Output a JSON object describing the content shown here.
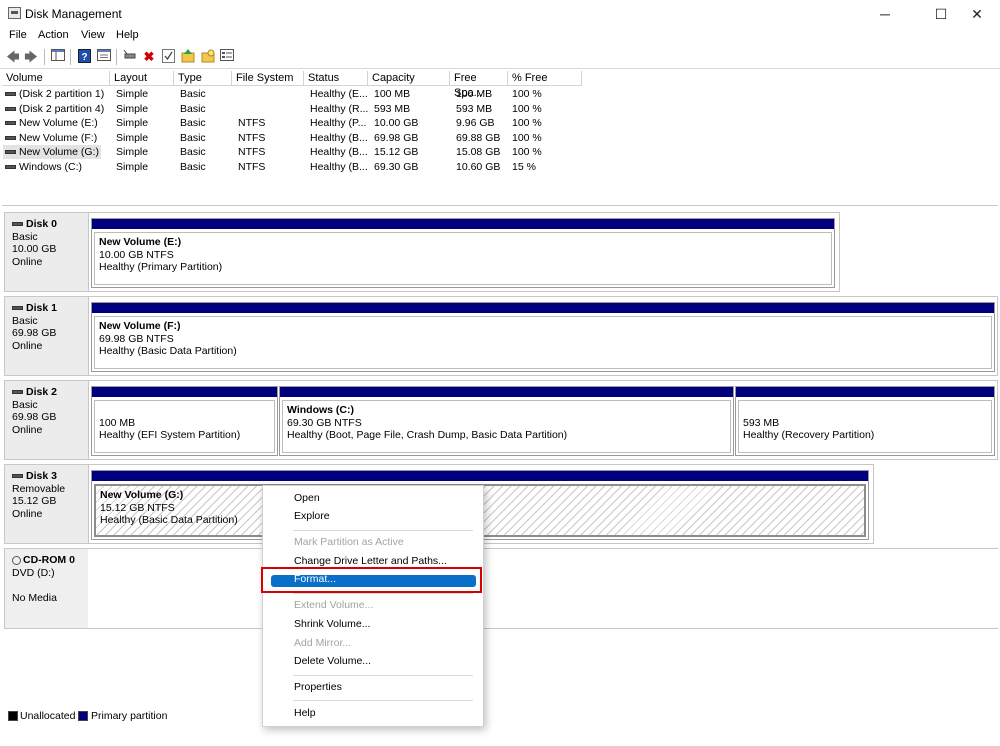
{
  "window": {
    "title": "Disk Management",
    "controls": {
      "minimize": "─",
      "maximize": "☐",
      "close": "✕"
    }
  },
  "menu": [
    "File",
    "Action",
    "View",
    "Help"
  ],
  "toolbar_icons": [
    "back-arrow-icon",
    "forward-arrow-icon",
    "console-tree-icon",
    "help-icon",
    "properties-icon",
    "connect-icon",
    "delete-icon",
    "checklist-icon",
    "up-folder-icon",
    "new-folder-icon",
    "settings-list-icon"
  ],
  "volume_table": {
    "columns": [
      "Volume",
      "Layout",
      "Type",
      "File System",
      "Status",
      "Capacity",
      "Free Spa...",
      "% Free"
    ],
    "rows": [
      [
        "(Disk 2 partition 1)",
        "Simple",
        "Basic",
        "",
        "Healthy (E...",
        "100 MB",
        "100 MB",
        "100 %"
      ],
      [
        "(Disk 2 partition 4)",
        "Simple",
        "Basic",
        "",
        "Healthy (R...",
        "593 MB",
        "593 MB",
        "100 %"
      ],
      [
        "New Volume (E:)",
        "Simple",
        "Basic",
        "NTFS",
        "Healthy (P...",
        "10.00 GB",
        "9.96 GB",
        "100 %"
      ],
      [
        "New Volume (F:)",
        "Simple",
        "Basic",
        "NTFS",
        "Healthy (B...",
        "69.98 GB",
        "69.88 GB",
        "100 %"
      ],
      [
        "New Volume (G:)",
        "Simple",
        "Basic",
        "NTFS",
        "Healthy (B...",
        "15.12 GB",
        "15.08 GB",
        "100 %"
      ],
      [
        "Windows (C:)",
        "Simple",
        "Basic",
        "NTFS",
        "Healthy (B...",
        "69.30 GB",
        "10.60 GB",
        "15 %"
      ]
    ],
    "selected_row": 4
  },
  "disks": [
    {
      "name": "Disk 0",
      "type": "Basic",
      "size": "10.00 GB",
      "status": "Online",
      "partitions": [
        {
          "name": "New Volume  (E:)",
          "size": "10.00 GB NTFS",
          "status": "Healthy (Primary Partition)"
        }
      ]
    },
    {
      "name": "Disk 1",
      "type": "Basic",
      "size": "69.98 GB",
      "status": "Online",
      "partitions": [
        {
          "name": "New Volume  (F:)",
          "size": "69.98 GB NTFS",
          "status": "Healthy (Basic Data Partition)"
        }
      ]
    },
    {
      "name": "Disk 2",
      "type": "Basic",
      "size": "69.98 GB",
      "status": "Online",
      "partitions": [
        {
          "name": "",
          "size": "100 MB",
          "status": "Healthy (EFI System Partition)"
        },
        {
          "name": "Windows  (C:)",
          "size": "69.30 GB NTFS",
          "status": "Healthy (Boot, Page File, Crash Dump, Basic Data Partition)"
        },
        {
          "name": "",
          "size": "593 MB",
          "status": "Healthy (Recovery Partition)"
        }
      ]
    },
    {
      "name": "Disk 3",
      "type": "Removable",
      "size": "15.12 GB",
      "status": "Online",
      "partitions": [
        {
          "name": "New Volume  (G:)",
          "size": "15.12 GB NTFS",
          "status": "Healthy (Basic Data Partition)"
        }
      ]
    }
  ],
  "cdrom": {
    "name": "CD-ROM 0",
    "drive": "DVD (D:)",
    "media": "No Media"
  },
  "legend": {
    "unallocated": "Unallocated",
    "primary": "Primary partition",
    "unallocated_color": "#000000",
    "primary_color": "#00007f"
  },
  "context_menu": {
    "open": "Open",
    "explore": "Explore",
    "mark_active": "Mark Partition as Active",
    "change_letter": "Change Drive Letter and Paths...",
    "format": "Format...",
    "extend": "Extend Volume...",
    "shrink": "Shrink Volume...",
    "add_mirror": "Add Mirror...",
    "delete": "Delete Volume...",
    "properties": "Properties",
    "help": "Help",
    "highlight_color": "#0a6fc8",
    "annotation_color": "#d60000"
  }
}
